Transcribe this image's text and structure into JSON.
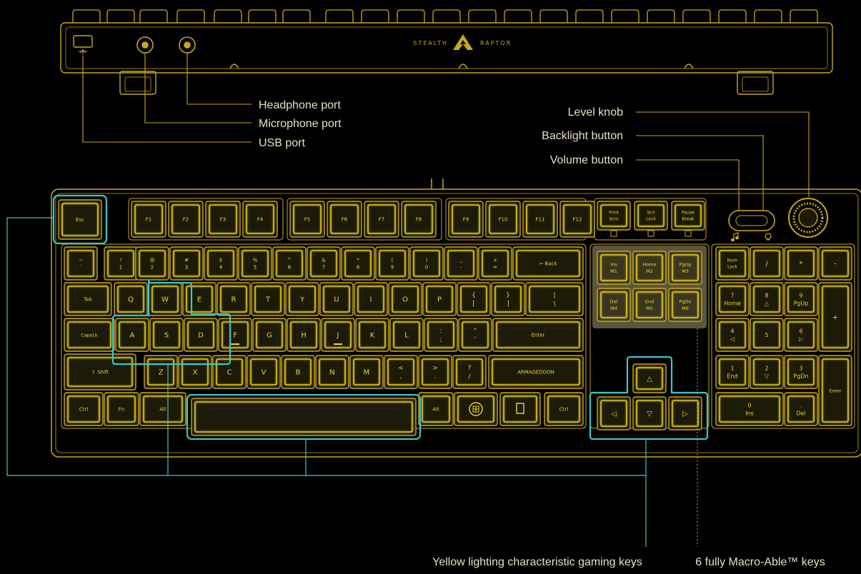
{
  "brand": {
    "left_text": "STEALTH",
    "right_text": "RAPTOR",
    "logo_icon": "raptor-logo-icon",
    "spacebar_brand": "ARMAGEDDON"
  },
  "colors": {
    "line": "#c9a81a",
    "key_fill": "#1c1a08",
    "key_glow": "#f3d81e",
    "highlight": "#3cc5c8",
    "macro_fill": "#6a6448",
    "text": "#e8e0c0"
  },
  "callouts": {
    "headphone_port": "Headphone port",
    "microphone_port": "Microphone port",
    "usb_port": "USB port",
    "level_knob": "Level knob",
    "backlight_button": "Backlight button",
    "volume_button": "Volume button",
    "gaming_keys": "Yellow lighting characteristic gaming keys",
    "macro_keys": "6 fully Macro-Able™ keys"
  },
  "icons": {
    "usb": "usb-icon",
    "headphone": "headphone-jack-icon",
    "microphone": "microphone-jack-icon",
    "windows": "windows-logo-icon",
    "menu": "menu-key-icon",
    "knob": "level-knob-icon",
    "music": "music-note-icon",
    "light": "light-bulb-icon"
  },
  "keys": {
    "esc": "Esc",
    "f": [
      "F1",
      "F2",
      "F3",
      "F4",
      "F5",
      "F6",
      "F7",
      "F8",
      "F9",
      "F10",
      "F11",
      "F12"
    ],
    "sys": [
      [
        "Print",
        "Scrn"
      ],
      [
        "Scrl",
        "Lock"
      ],
      [
        "Pause",
        "Break"
      ]
    ],
    "num_row": [
      [
        "~",
        "`"
      ],
      [
        "!",
        "1"
      ],
      [
        "@",
        "2"
      ],
      [
        "#",
        "3"
      ],
      [
        "$",
        "4"
      ],
      [
        "%",
        "5"
      ],
      [
        "^",
        "6"
      ],
      [
        "&",
        "7"
      ],
      [
        "*",
        "8"
      ],
      [
        "(",
        "9"
      ],
      [
        ")",
        "0"
      ],
      [
        "_",
        "-"
      ],
      [
        "+",
        "="
      ]
    ],
    "back": "Back",
    "tab": "Tab",
    "q_row": [
      "Q",
      "W",
      "E",
      "R",
      "T",
      "Y",
      "U",
      "I",
      "O",
      "P"
    ],
    "q_row_sym": [
      [
        "{",
        "["
      ],
      [
        "}",
        "]"
      ],
      [
        "|",
        "\\"
      ]
    ],
    "caps": "CapsLk",
    "a_row": [
      "A",
      "S",
      "D",
      "F",
      "G",
      "H",
      "J",
      "K",
      "L"
    ],
    "a_row_sym": [
      [
        ":",
        ";"
      ],
      [
        "\"",
        "'"
      ]
    ],
    "enter": "Enter",
    "shift": "Shift",
    "z_row": [
      "Z",
      "X",
      "C",
      "V",
      "B",
      "N",
      "M"
    ],
    "z_row_sym": [
      [
        "<",
        ","
      ],
      [
        ">",
        "."
      ],
      [
        "?",
        "/"
      ]
    ],
    "ctrl": "Ctrl",
    "fn": "Fn",
    "alt": "Alt",
    "nav": [
      [
        "Ins",
        "M1"
      ],
      [
        "Home",
        "M2"
      ],
      [
        "PgUp",
        "M3"
      ],
      [
        "Del",
        "M4"
      ],
      [
        "End",
        "M5"
      ],
      [
        "PgDn",
        "M6"
      ]
    ],
    "numpad": {
      "numlock": [
        "Num",
        "Lock"
      ],
      "slash": "/",
      "star": "*",
      "minus": "-",
      "plus": "+",
      "enter": "Enter",
      "n7": [
        "7",
        "Home"
      ],
      "n8": [
        "8",
        "△"
      ],
      "n9": [
        "9",
        "PgUp"
      ],
      "n4": [
        "4",
        "◁"
      ],
      "n5": [
        "5",
        ""
      ],
      "n6": [
        "6",
        "▷"
      ],
      "n1": [
        "1",
        "End"
      ],
      "n2": [
        "2",
        "▽"
      ],
      "n3": [
        "3",
        "PgDn"
      ],
      "n0": [
        "0",
        "Ins"
      ],
      "ndot": [
        ".",
        "Del"
      ]
    },
    "arrows": [
      "△",
      "◁",
      "▽",
      "▷"
    ]
  }
}
